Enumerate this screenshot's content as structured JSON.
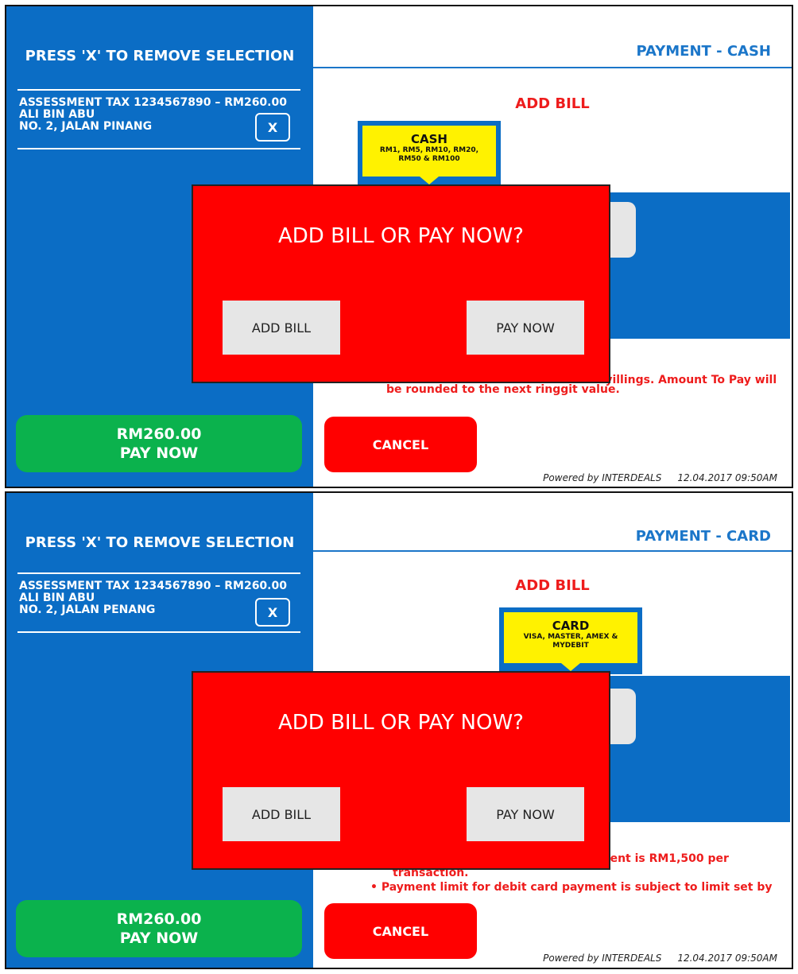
{
  "screens": [
    {
      "left_title": "PRESS 'X' TO REMOVE SELECTION",
      "bill_line1": "ASSESSMENT TAX 1234567890 – RM260.00",
      "bill_line2": "ALI BIN ABU",
      "bill_line3": "NO. 2, JALAN PINANG",
      "remove_label": "X",
      "pay_amount": "RM260.00",
      "pay_label": "PAY NOW",
      "header_title": "PAYMENT - CASH",
      "add_bill_heading": "ADD BILL",
      "method_title": "CASH",
      "method_detail_1": "RM1, RM5, RM10, RM20,",
      "method_detail_2": "RM50 & RM100",
      "note_1": "syillings. Amount To Pay will",
      "note_2": "be rounded to the next ringgit value.",
      "note_3": "",
      "cancel_label": "CANCEL",
      "footer_powered": "Powered by INTERDEALS",
      "footer_datetime": "12.04.2017  09:50AM",
      "dialog_question": "ADD BILL OR PAY NOW?",
      "dialog_add_bill": "ADD BILL",
      "dialog_pay_now": "PAY NOW"
    },
    {
      "left_title": "PRESS 'X' TO REMOVE SELECTION",
      "bill_line1": "ASSESSMENT TAX 1234567890  – RM260.00",
      "bill_line2": "ALI BIN ABU",
      "bill_line3": "NO. 2, JALAN PENANG",
      "remove_label": "X",
      "pay_amount": "RM260.00",
      "pay_label": "PAY NOW",
      "header_title": "PAYMENT - CARD",
      "add_bill_heading": "ADD BILL",
      "method_title": "CARD",
      "method_detail_1": "VISA, MASTER, AMEX &",
      "method_detail_2": "MYDEBIT",
      "note_1": "ment is RM1,500 per",
      "note_2": "transaction.",
      "note_3": "•   Payment limit for debit card payment is subject to limit set by",
      "cancel_label": "CANCEL",
      "footer_powered": "Powered by INTERDEALS",
      "footer_datetime": "12.04.2017  09:50AM",
      "dialog_question": "ADD BILL OR PAY NOW?",
      "dialog_add_bill": "ADD BILL",
      "dialog_pay_now": "PAY NOW"
    }
  ],
  "colors": {
    "sidebar_blue": "#0b6dc5",
    "header_blue": "#1b76c9",
    "alert_red": "#ff0000",
    "pay_green": "#0bb24d",
    "tag_yellow": "#fff200"
  }
}
